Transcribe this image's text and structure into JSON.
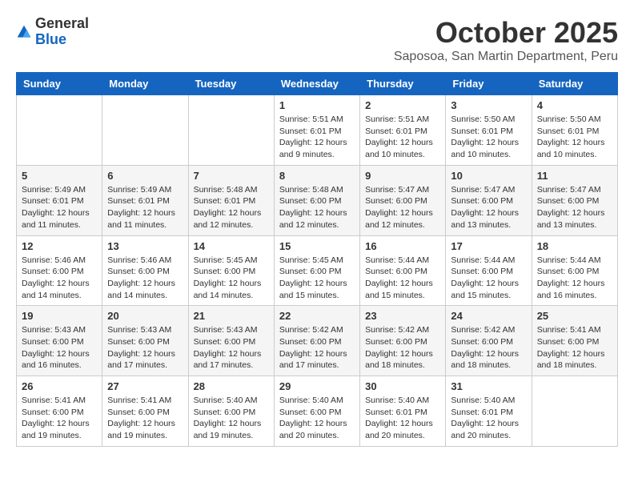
{
  "logo": {
    "general": "General",
    "blue": "Blue"
  },
  "header": {
    "month": "October 2025",
    "location": "Saposoa, San Martin Department, Peru"
  },
  "days_of_week": [
    "Sunday",
    "Monday",
    "Tuesday",
    "Wednesday",
    "Thursday",
    "Friday",
    "Saturday"
  ],
  "weeks": [
    [
      {
        "day": "",
        "info": ""
      },
      {
        "day": "",
        "info": ""
      },
      {
        "day": "",
        "info": ""
      },
      {
        "day": "1",
        "info": "Sunrise: 5:51 AM\nSunset: 6:01 PM\nDaylight: 12 hours and 9 minutes."
      },
      {
        "day": "2",
        "info": "Sunrise: 5:51 AM\nSunset: 6:01 PM\nDaylight: 12 hours and 10 minutes."
      },
      {
        "day": "3",
        "info": "Sunrise: 5:50 AM\nSunset: 6:01 PM\nDaylight: 12 hours and 10 minutes."
      },
      {
        "day": "4",
        "info": "Sunrise: 5:50 AM\nSunset: 6:01 PM\nDaylight: 12 hours and 10 minutes."
      }
    ],
    [
      {
        "day": "5",
        "info": "Sunrise: 5:49 AM\nSunset: 6:01 PM\nDaylight: 12 hours and 11 minutes."
      },
      {
        "day": "6",
        "info": "Sunrise: 5:49 AM\nSunset: 6:01 PM\nDaylight: 12 hours and 11 minutes."
      },
      {
        "day": "7",
        "info": "Sunrise: 5:48 AM\nSunset: 6:01 PM\nDaylight: 12 hours and 12 minutes."
      },
      {
        "day": "8",
        "info": "Sunrise: 5:48 AM\nSunset: 6:00 PM\nDaylight: 12 hours and 12 minutes."
      },
      {
        "day": "9",
        "info": "Sunrise: 5:47 AM\nSunset: 6:00 PM\nDaylight: 12 hours and 12 minutes."
      },
      {
        "day": "10",
        "info": "Sunrise: 5:47 AM\nSunset: 6:00 PM\nDaylight: 12 hours and 13 minutes."
      },
      {
        "day": "11",
        "info": "Sunrise: 5:47 AM\nSunset: 6:00 PM\nDaylight: 12 hours and 13 minutes."
      }
    ],
    [
      {
        "day": "12",
        "info": "Sunrise: 5:46 AM\nSunset: 6:00 PM\nDaylight: 12 hours and 14 minutes."
      },
      {
        "day": "13",
        "info": "Sunrise: 5:46 AM\nSunset: 6:00 PM\nDaylight: 12 hours and 14 minutes."
      },
      {
        "day": "14",
        "info": "Sunrise: 5:45 AM\nSunset: 6:00 PM\nDaylight: 12 hours and 14 minutes."
      },
      {
        "day": "15",
        "info": "Sunrise: 5:45 AM\nSunset: 6:00 PM\nDaylight: 12 hours and 15 minutes."
      },
      {
        "day": "16",
        "info": "Sunrise: 5:44 AM\nSunset: 6:00 PM\nDaylight: 12 hours and 15 minutes."
      },
      {
        "day": "17",
        "info": "Sunrise: 5:44 AM\nSunset: 6:00 PM\nDaylight: 12 hours and 15 minutes."
      },
      {
        "day": "18",
        "info": "Sunrise: 5:44 AM\nSunset: 6:00 PM\nDaylight: 12 hours and 16 minutes."
      }
    ],
    [
      {
        "day": "19",
        "info": "Sunrise: 5:43 AM\nSunset: 6:00 PM\nDaylight: 12 hours and 16 minutes."
      },
      {
        "day": "20",
        "info": "Sunrise: 5:43 AM\nSunset: 6:00 PM\nDaylight: 12 hours and 17 minutes."
      },
      {
        "day": "21",
        "info": "Sunrise: 5:43 AM\nSunset: 6:00 PM\nDaylight: 12 hours and 17 minutes."
      },
      {
        "day": "22",
        "info": "Sunrise: 5:42 AM\nSunset: 6:00 PM\nDaylight: 12 hours and 17 minutes."
      },
      {
        "day": "23",
        "info": "Sunrise: 5:42 AM\nSunset: 6:00 PM\nDaylight: 12 hours and 18 minutes."
      },
      {
        "day": "24",
        "info": "Sunrise: 5:42 AM\nSunset: 6:00 PM\nDaylight: 12 hours and 18 minutes."
      },
      {
        "day": "25",
        "info": "Sunrise: 5:41 AM\nSunset: 6:00 PM\nDaylight: 12 hours and 18 minutes."
      }
    ],
    [
      {
        "day": "26",
        "info": "Sunrise: 5:41 AM\nSunset: 6:00 PM\nDaylight: 12 hours and 19 minutes."
      },
      {
        "day": "27",
        "info": "Sunrise: 5:41 AM\nSunset: 6:00 PM\nDaylight: 12 hours and 19 minutes."
      },
      {
        "day": "28",
        "info": "Sunrise: 5:40 AM\nSunset: 6:00 PM\nDaylight: 12 hours and 19 minutes."
      },
      {
        "day": "29",
        "info": "Sunrise: 5:40 AM\nSunset: 6:00 PM\nDaylight: 12 hours and 20 minutes."
      },
      {
        "day": "30",
        "info": "Sunrise: 5:40 AM\nSunset: 6:01 PM\nDaylight: 12 hours and 20 minutes."
      },
      {
        "day": "31",
        "info": "Sunrise: 5:40 AM\nSunset: 6:01 PM\nDaylight: 12 hours and 20 minutes."
      },
      {
        "day": "",
        "info": ""
      }
    ]
  ]
}
